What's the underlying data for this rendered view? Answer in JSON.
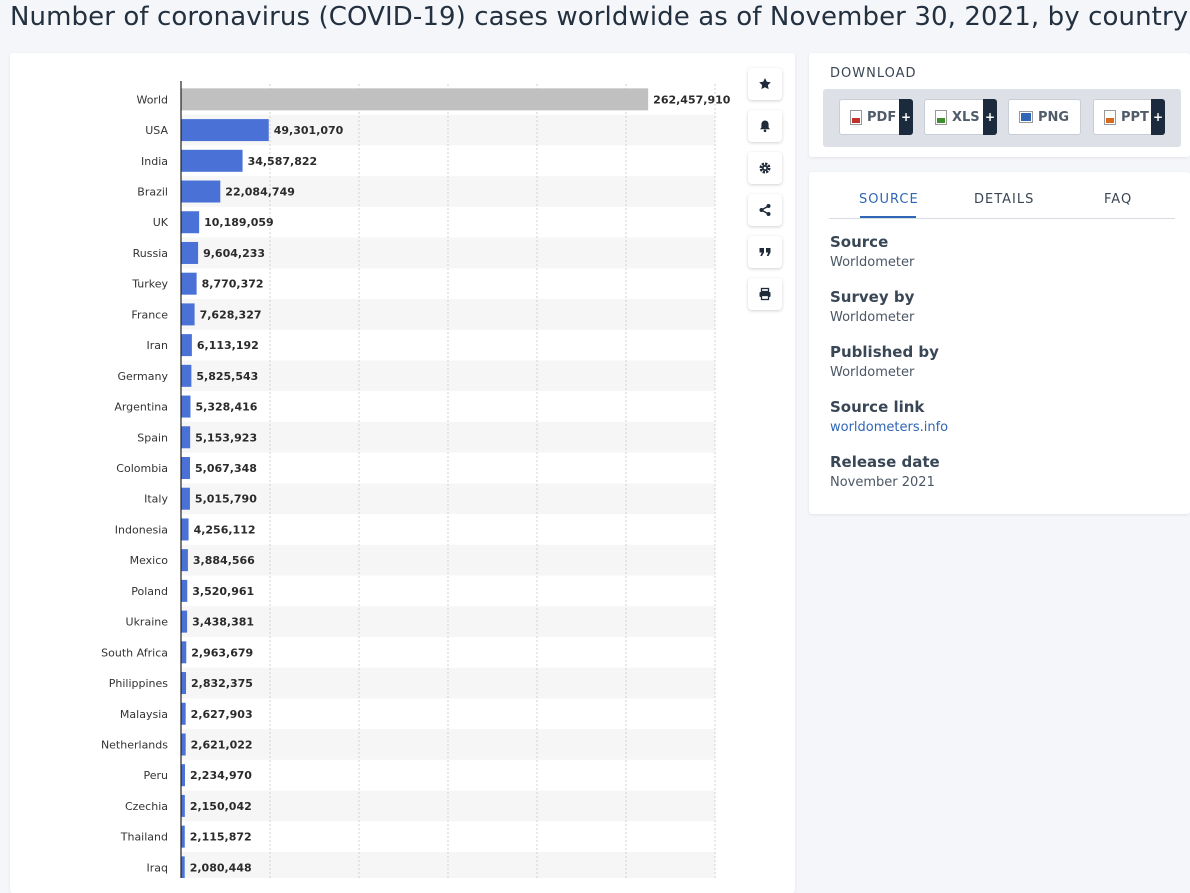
{
  "title": "Number of coronavirus (COVID-19) cases worldwide as of November 30, 2021, by country",
  "chart_data": {
    "type": "bar",
    "orientation": "horizontal",
    "categories": [
      "World",
      "USA",
      "India",
      "Brazil",
      "UK",
      "Russia",
      "Turkey",
      "France",
      "Iran",
      "Germany",
      "Argentina",
      "Spain",
      "Colombia",
      "Italy",
      "Indonesia",
      "Mexico",
      "Poland",
      "Ukraine",
      "South Africa",
      "Philippines",
      "Malaysia",
      "Netherlands",
      "Peru",
      "Czechia",
      "Thailand",
      "Iraq"
    ],
    "values": [
      262457910,
      49301070,
      34587822,
      22084749,
      10189059,
      9604233,
      8770372,
      7628327,
      6113192,
      5825543,
      5328416,
      5153923,
      5067348,
      5015790,
      4256112,
      3884566,
      3520961,
      3438381,
      2963679,
      2832375,
      2627903,
      2621022,
      2234970,
      2150042,
      2115872,
      2080448
    ],
    "value_labels": [
      "262,457,910",
      "49,301,070",
      "34,587,822",
      "22,084,749",
      "10,189,059",
      "9,604,233",
      "8,770,372",
      "7,628,327",
      "6,113,192",
      "5,825,543",
      "5,328,416",
      "5,153,923",
      "5,067,348",
      "5,015,790",
      "4,256,112",
      "3,884,566",
      "3,520,961",
      "3,438,381",
      "2,963,679",
      "2,832,375",
      "2,627,903",
      "2,621,022",
      "2,234,970",
      "2,150,042",
      "2,115,872",
      "2,080,448"
    ],
    "highlight_category": "World",
    "colors": {
      "bar": "#4a72d6",
      "highlight": "#c0c0c0",
      "label": "#2b2b2b"
    },
    "xlim": [
      0,
      300000000
    ],
    "grid": true,
    "xlabel": "",
    "ylabel": ""
  },
  "tools": [
    {
      "name": "favorite-icon"
    },
    {
      "name": "notification-icon"
    },
    {
      "name": "settings-icon"
    },
    {
      "name": "share-icon"
    },
    {
      "name": "citation-icon"
    },
    {
      "name": "print-icon"
    }
  ],
  "download": {
    "title": "DOWNLOAD",
    "buttons": [
      {
        "label": "PDF",
        "icon_color": "#c0322b"
      },
      {
        "label": "XLS",
        "icon_color": "#3e8e2f"
      },
      {
        "label": "PNG",
        "icon_color": "#2f66b5"
      },
      {
        "label": "PPT",
        "icon_color": "#d86a1e"
      }
    ]
  },
  "info": {
    "tabs": [
      "SOURCE",
      "DETAILS",
      "FAQ"
    ],
    "active_tab": "SOURCE",
    "source_label": "Source",
    "source_value": "Worldometer",
    "survey_label": "Survey by",
    "survey_value": "Worldometer",
    "published_label": "Published by",
    "published_value": "Worldometer",
    "link_label": "Source link",
    "link_value": "worldometers.info",
    "release_label": "Release date",
    "release_value": "November 2021"
  }
}
